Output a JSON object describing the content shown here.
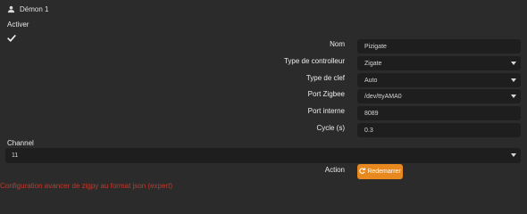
{
  "header": {
    "title": "Démon 1",
    "icon": "users-icon"
  },
  "activer": {
    "label": "Activer",
    "checked": true,
    "icon": "check-icon"
  },
  "form": {
    "nom": {
      "label": "Nom",
      "value": "Pizigate"
    },
    "type_controleur": {
      "label": "Type de controlleur",
      "value": "Zigate"
    },
    "type_clef": {
      "label": "Type de clef",
      "value": "Auto"
    },
    "port_zigbee": {
      "label": "Port Zigbee",
      "value": "/dev/ttyAMA0"
    },
    "port_interne": {
      "label": "Port interne",
      "value": "8089"
    },
    "cycle": {
      "label": "Cycle (s)",
      "value": "0.3"
    }
  },
  "channel": {
    "label": "Channel",
    "value": "11"
  },
  "action": {
    "label": "Action",
    "button_label": "Redemarrer",
    "button_icon": "refresh-icon",
    "button_color": "#e8891f"
  },
  "footer": {
    "expert_link": "Configuration avancer de zigpy au format json (expert)",
    "link_color": "#c0392b"
  }
}
